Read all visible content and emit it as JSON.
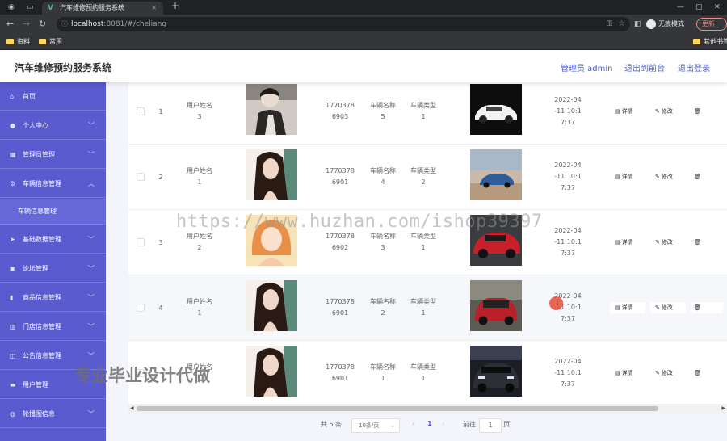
{
  "browser": {
    "tab_title": "汽车维修预约服务系统",
    "url_host": "localhost",
    "url_port": ":8081",
    "url_path": "/#/cheliang",
    "incognito_label": "无痕模式",
    "update_label": "更新",
    "bookmarks": [
      "资料",
      "常用"
    ],
    "other_bookmarks": "其他书签"
  },
  "header": {
    "title": "汽车维修预约服务系统",
    "user_label": "管理员 admin",
    "front_link": "退出到前台",
    "logout_link": "退出登录"
  },
  "sidebar": {
    "items": [
      {
        "label": "首页",
        "icon": "home-icon",
        "has_arrow": false
      },
      {
        "label": "个人中心",
        "icon": "user-icon",
        "has_arrow": true
      },
      {
        "label": "管理员管理",
        "icon": "admin-icon",
        "has_arrow": true
      },
      {
        "label": "车辆信息管理",
        "icon": "car-icon",
        "has_arrow": true,
        "expanded": true
      },
      {
        "label": "基础数据管理",
        "icon": "send-icon",
        "has_arrow": true
      },
      {
        "label": "论坛管理",
        "icon": "forum-icon",
        "has_arrow": true
      },
      {
        "label": "商品信息管理",
        "icon": "chart-icon",
        "has_arrow": true
      },
      {
        "label": "门店信息管理",
        "icon": "store-icon",
        "has_arrow": true
      },
      {
        "label": "公告信息管理",
        "icon": "notice-icon",
        "has_arrow": true
      },
      {
        "label": "用户管理",
        "icon": "users-icon",
        "has_arrow": false
      },
      {
        "label": "轮播图信息",
        "icon": "image-icon",
        "has_arrow": true
      }
    ],
    "sub_item": "车辆信息管理"
  },
  "table": {
    "rows": [
      {
        "index": "1",
        "user_line1": "用户姓名",
        "user_line2": "3",
        "phone_line1": "1770378",
        "phone_line2": "6903",
        "car_name_line1": "车辆名称",
        "car_name_line2": "5",
        "car_type_line1": "车辆类型",
        "car_type_line2": "1",
        "time_line1": "2022-04",
        "time_line2": "-11 10:1",
        "time_line3": "7:37"
      },
      {
        "index": "2",
        "user_line1": "用户姓名",
        "user_line2": "1",
        "phone_line1": "1770378",
        "phone_line2": "6901",
        "car_name_line1": "车辆名称",
        "car_name_line2": "4",
        "car_type_line1": "车辆类型",
        "car_type_line2": "2",
        "time_line1": "2022-04",
        "time_line2": "-11 10:1",
        "time_line3": "7:37"
      },
      {
        "index": "3",
        "user_line1": "用户姓名",
        "user_line2": "2",
        "phone_line1": "1770378",
        "phone_line2": "6902",
        "car_name_line1": "车辆名称",
        "car_name_line2": "3",
        "car_type_line1": "车辆类型",
        "car_type_line2": "1",
        "time_line1": "2022-04",
        "time_line2": "-11 10:1",
        "time_line3": "7:37"
      },
      {
        "index": "4",
        "user_line1": "用户姓名",
        "user_line2": "1",
        "phone_line1": "1770378",
        "phone_line2": "6901",
        "car_name_line1": "车辆名称",
        "car_name_line2": "2",
        "car_type_line1": "车辆类型",
        "car_type_line2": "1",
        "time_line1": "2022-04",
        "time_line2": "-11 10:1",
        "time_line3": "7:37"
      },
      {
        "index": "",
        "user_line1": "用户姓名",
        "user_line2": "",
        "phone_line1": "1770378",
        "phone_line2": "6901",
        "car_name_line1": "车辆名称",
        "car_name_line2": "1",
        "car_type_line1": "车辆类型",
        "car_type_line2": "1",
        "time_line1": "2022-04",
        "time_line2": "-11 10:1",
        "time_line3": "7:37"
      }
    ],
    "detail_label": "详情",
    "edit_label": "修改"
  },
  "pagination": {
    "total": "共 5 条",
    "page_size": "10条/页",
    "current_page": "1",
    "goto_label": "前往",
    "goto_value": "1",
    "page_suffix": "页"
  },
  "overlays": {
    "watermark_url": "https://www.huzhan.com/ishop39397",
    "watermark_cn": "专业毕业设计代做"
  },
  "colors": {
    "sidebar_bg": "#5a5bcf",
    "accent": "#4a5fd0"
  }
}
